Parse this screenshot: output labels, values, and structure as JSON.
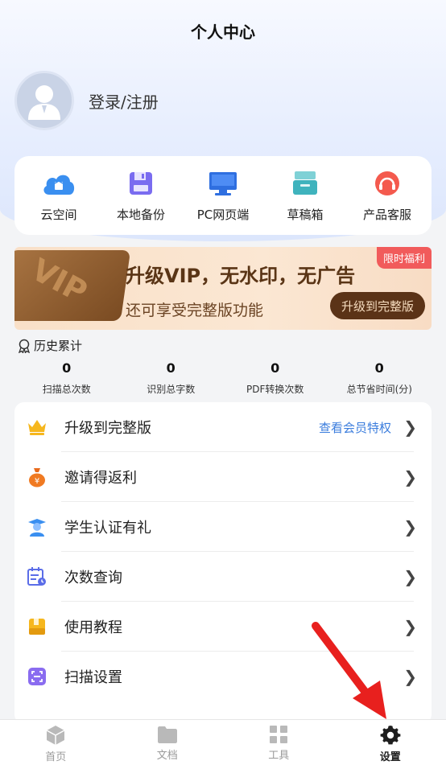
{
  "header": {
    "title": "个人中心"
  },
  "user": {
    "login_text": "登录/注册"
  },
  "quick_actions": [
    {
      "label": "云空间",
      "icon": "cloud-icon"
    },
    {
      "label": "本地备份",
      "icon": "save-disk-icon"
    },
    {
      "label": "PC网页端",
      "icon": "monitor-icon"
    },
    {
      "label": "草稿箱",
      "icon": "drafts-box-icon"
    },
    {
      "label": "产品客服",
      "icon": "headset-icon"
    }
  ],
  "vip_banner": {
    "card_text": "VIP",
    "title": "升级VIP，无水印，无广告",
    "subtitle": "还可享受完整版功能",
    "tag": "限时福利",
    "button": "升级到完整版"
  },
  "history": {
    "title": "历史累计",
    "stats": [
      {
        "value": "0",
        "label": "扫描总次数"
      },
      {
        "value": "0",
        "label": "识别总字数"
      },
      {
        "value": "0",
        "label": "PDF转换次数"
      },
      {
        "value": "0",
        "label": "总节省时间(分)"
      }
    ]
  },
  "menu": [
    {
      "label": "升级到完整版",
      "extra": "查看会员特权",
      "icon": "crown-icon"
    },
    {
      "label": "邀请得返利",
      "extra": "",
      "icon": "money-bag-icon"
    },
    {
      "label": "学生认证有礼",
      "extra": "",
      "icon": "student-icon"
    },
    {
      "label": "次数查询",
      "extra": "",
      "icon": "calendar-query-icon"
    },
    {
      "label": "使用教程",
      "extra": "",
      "icon": "tutorial-book-icon"
    },
    {
      "label": "扫描设置",
      "extra": "",
      "icon": "scan-settings-icon"
    }
  ],
  "tabs": [
    {
      "label": "首页",
      "icon": "home-cube-icon"
    },
    {
      "label": "文档",
      "icon": "folder-icon"
    },
    {
      "label": "工具",
      "icon": "grid-tools-icon"
    },
    {
      "label": "设置",
      "icon": "gear-icon",
      "active": true
    }
  ],
  "colors": {
    "accent_blue": "#3b7ddd",
    "vip_brown": "#5b3317",
    "tag_red": "#f15b5b",
    "arrow_red": "#e8201e"
  }
}
